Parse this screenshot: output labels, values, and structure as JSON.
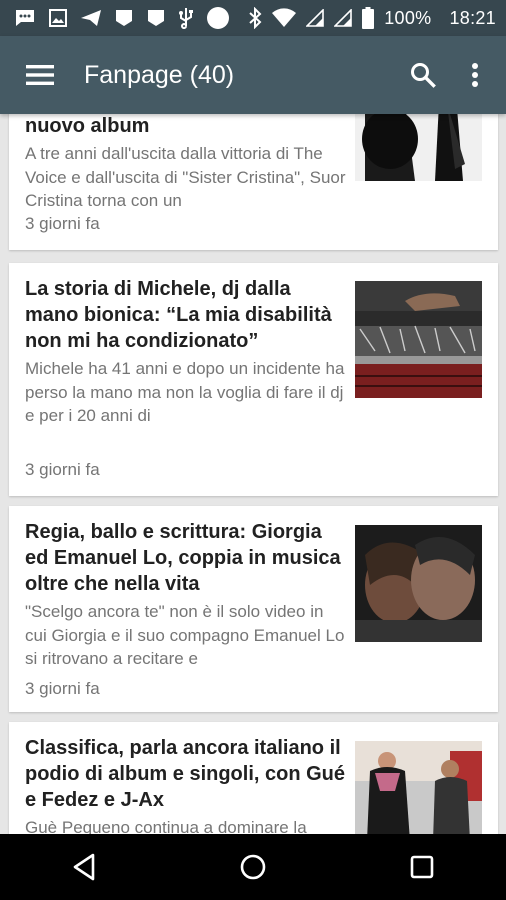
{
  "status_bar": {
    "battery": "100%",
    "time": "18:21",
    "left_icons": [
      "chat-icon",
      "image-icon",
      "send-icon",
      "notification-icon",
      "notification-icon",
      "usb-icon",
      "circle-icon"
    ],
    "right_icons": [
      "bluetooth-icon",
      "wifi-icon",
      "signal-icon",
      "signal-icon",
      "battery-icon"
    ]
  },
  "app_bar": {
    "title": "Fanpage (40)",
    "actions": [
      "search-icon",
      "more-vert-icon"
    ]
  },
  "articles": [
    {
      "title": "nuovo album",
      "summary": "A tre anni dall'uscita dalla vittoria di The Voice e dall'uscita di \"Sister Cristina\", Suor Cristina torna con un",
      "time": "3 giorni fa"
    },
    {
      "title": "La storia di Michele, dj dalla mano bionica: “La mia disabilità non mi ha condizionato”",
      "summary": "Michele ha 41 anni e dopo un incidente ha perso la mano ma non la voglia di fare il dj e per i 20 anni di",
      "time": "3 giorni fa"
    },
    {
      "title": "Regia, ballo e scrittura: Giorgia ed Emanuel Lo, coppia in musica oltre che nella vita",
      "summary": "\"Scelgo ancora te\" non è il solo video in cui Giorgia e il suo compagno Emanuel Lo si ritrovano a recitare e",
      "time": "3 giorni fa"
    },
    {
      "title": "Classifica, parla ancora italiano il podio di album e singoli, con Gué e Fedez e J-Ax",
      "summary": "Guè Pequeno continua a dominare la",
      "time": ""
    }
  ],
  "nav_bar": [
    "back-icon",
    "home-icon",
    "recents-icon"
  ],
  "colors": {
    "status_bar": "#37474f",
    "app_bar": "#455a64",
    "background": "#e6e6e6",
    "title_text": "#212121",
    "secondary_text": "#757575"
  }
}
